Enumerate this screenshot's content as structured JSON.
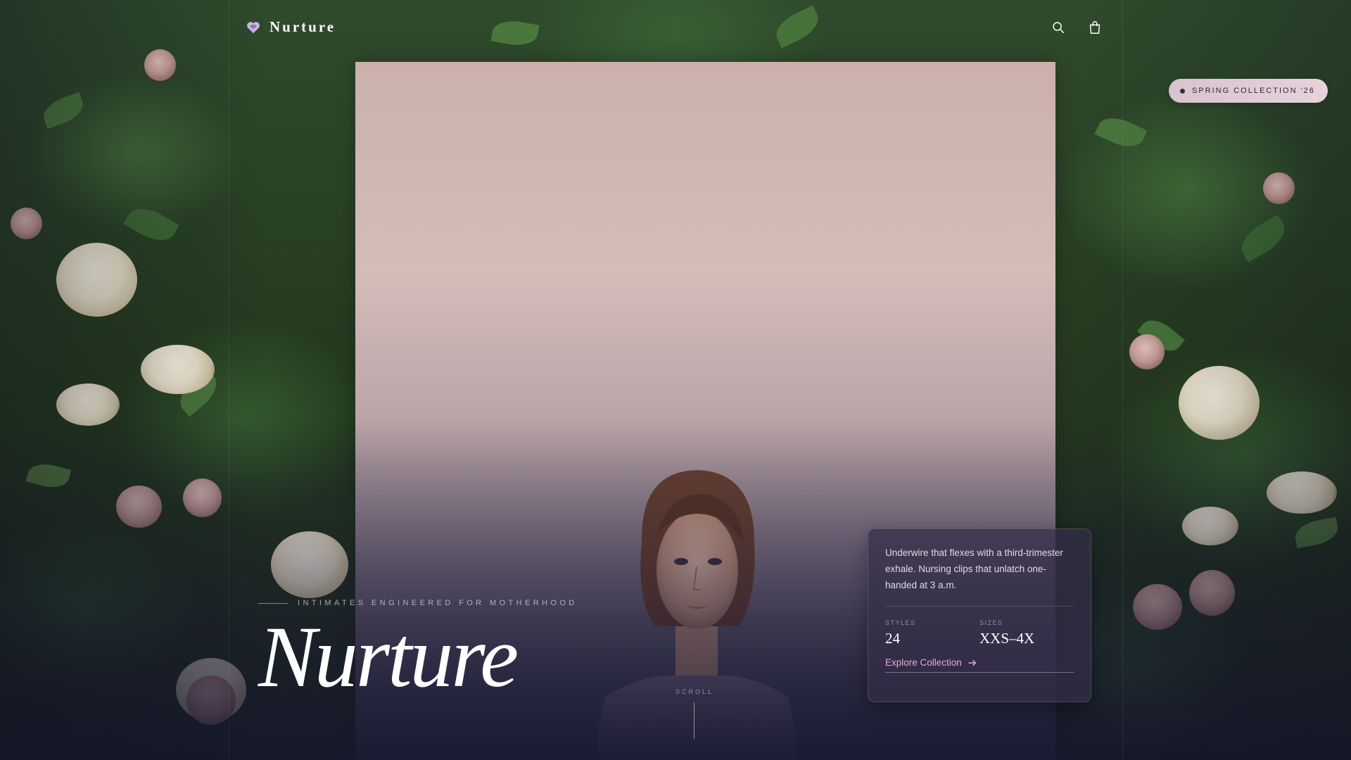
{
  "header": {
    "brand_name": "Nurture",
    "icons": [
      "heart-logo-icon",
      "search-icon",
      "bag-icon"
    ]
  },
  "badge": {
    "label": "SPRING COLLECTION '26"
  },
  "hero": {
    "eyebrow": "INTIMATES ENGINEERED FOR MOTHERHOOD",
    "title": "Nurture",
    "scroll_label": "SCROLL"
  },
  "info_card": {
    "description": "Underwire that flexes with a third-trimester exhale. Nursing clips that unlatch one-handed at 3 a.m.",
    "stats": [
      {
        "label": "STYLES",
        "value": "24"
      },
      {
        "label": "SIZES",
        "value": "XXS–4X"
      }
    ],
    "cta_label": "Explore Collection",
    "cta_icon": "arrow-right-icon"
  },
  "colors": {
    "accent_pink": "#e9a9d3",
    "badge_background": "#e2ccd6",
    "card_background": "#342e48",
    "text_white": "#ffffff"
  }
}
